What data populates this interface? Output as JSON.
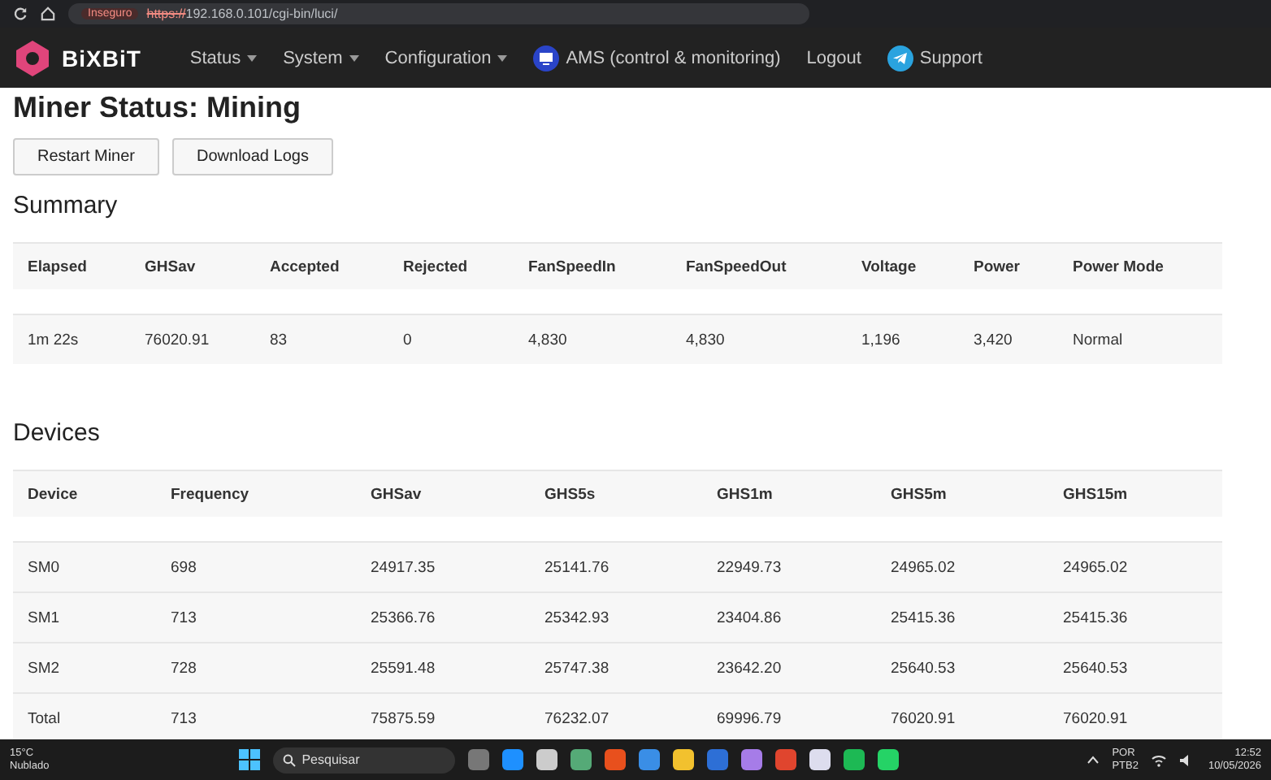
{
  "browser": {
    "security": "Inseguro",
    "url_scheme": "https://",
    "url_rest": "192.168.0.101/cgi-bin/luci/"
  },
  "nav": {
    "logo": "BiXBiT",
    "items": [
      {
        "label": "Status",
        "kind": "dropdown"
      },
      {
        "label": "System",
        "kind": "dropdown"
      },
      {
        "label": "Configuration",
        "kind": "dropdown"
      },
      {
        "label": "AMS (control & monitoring)",
        "kind": "ams"
      },
      {
        "label": "Logout",
        "kind": "link"
      },
      {
        "label": "Support",
        "kind": "telegram"
      }
    ]
  },
  "title": "Miner Status: Mining",
  "buttons": [
    "Restart Miner",
    "Download Logs"
  ],
  "summary": {
    "heading": "Summary",
    "columns": [
      "Elapsed",
      "GHSav",
      "Accepted",
      "Rejected",
      "FanSpeedIn",
      "FanSpeedOut",
      "Voltage",
      "Power",
      "Power Mode"
    ],
    "rows": [
      [
        "1m 22s",
        "76020.91",
        "83",
        "0",
        "4,830",
        "4,830",
        "1,196",
        "3,420",
        "Normal"
      ]
    ]
  },
  "devices": {
    "heading": "Devices",
    "columns": [
      "Device",
      "Frequency",
      "GHSav",
      "GHS5s",
      "GHS1m",
      "GHS5m",
      "GHS15m"
    ],
    "rows": [
      [
        "SM0",
        "698",
        "24917.35",
        "25141.76",
        "22949.73",
        "24965.02",
        "24965.02"
      ],
      [
        "SM1",
        "713",
        "25366.76",
        "25342.93",
        "23404.86",
        "25415.36",
        "25415.36"
      ],
      [
        "SM2",
        "728",
        "25591.48",
        "25747.38",
        "23642.20",
        "25640.53",
        "25640.53"
      ],
      [
        "Total",
        "713",
        "75875.59",
        "76232.07",
        "69996.79",
        "76020.91",
        "76020.91"
      ]
    ]
  },
  "taskbar": {
    "temperature": "15°C",
    "weather": "Nublado",
    "search": "Pesquisar",
    "language": "POR",
    "layout": "PTB2",
    "time": "12:52",
    "date": "10/05/2026"
  }
}
